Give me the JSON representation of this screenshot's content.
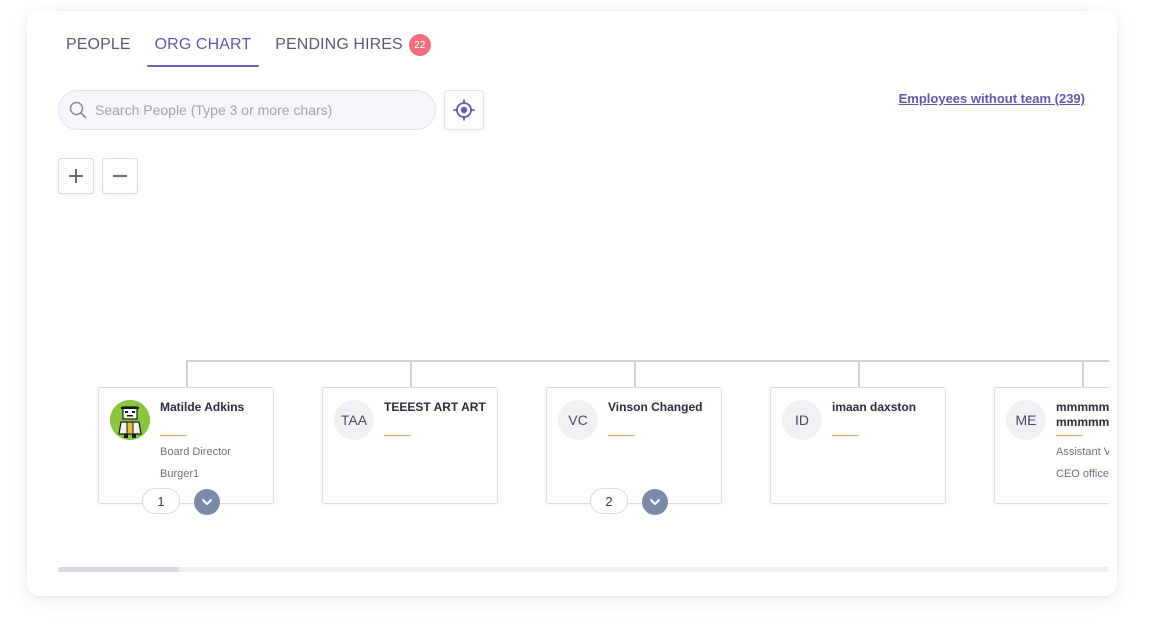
{
  "tabs": [
    {
      "label": "PEOPLE",
      "active": false
    },
    {
      "label": "ORG CHART",
      "active": true
    },
    {
      "label": "PENDING HIRES",
      "active": false,
      "badge": "22"
    }
  ],
  "search": {
    "placeholder": "Search People (Type 3 or more chars)",
    "value": ""
  },
  "employees_without_team_link": "Employees without team (239)",
  "zoom": {
    "in_icon": "plus-icon",
    "out_icon": "minus-icon"
  },
  "locate_icon": "crosshair-icon",
  "nodes": [
    {
      "initials": "",
      "avatar": "photo",
      "name": "Matilde Adkins",
      "title": "Board Director",
      "team": "Burger1",
      "reports": "1"
    },
    {
      "initials": "TAA",
      "name": "TEEEST ART ART",
      "title": "",
      "team": ""
    },
    {
      "initials": "VC",
      "name": "Vinson Changed",
      "title": "",
      "team": "",
      "reports": "2"
    },
    {
      "initials": "ID",
      "name": "imaan daxston",
      "title": "",
      "team": ""
    },
    {
      "initials": "ME",
      "name": "mmmmmmmmmmmmmmmmmmmm",
      "title": "Assistant Vice President",
      "team": "CEO office"
    }
  ],
  "colors": {
    "accent": "#5e5aa8",
    "badge": "#f06e7e",
    "expand": "#7a8aa8",
    "dash": "#e8a060"
  }
}
